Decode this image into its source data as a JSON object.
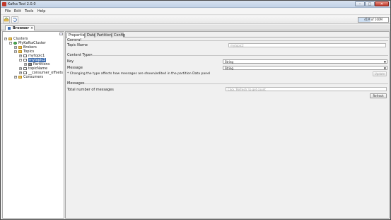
{
  "window": {
    "title": "Kafka Tool  2.0.0",
    "icons": {
      "app": "kafka-app-icon",
      "minimize": "minimize-icon",
      "maximize": "maximize-icon",
      "close": "close-icon"
    }
  },
  "menu": {
    "file": "File",
    "edit": "Edit",
    "tools": "Tools",
    "help": "Help"
  },
  "toolbar": {
    "connect_icon": "connect-icon",
    "refresh_icon": "refresh-icon",
    "memory_text": "41M of 100M",
    "memory_fraction": 0.41
  },
  "browser_tab": {
    "label": "Browser",
    "close": "×"
  },
  "tree": {
    "root": "Clusters",
    "cluster": "MyKafkaCluster",
    "brokers": "Brokers",
    "topics": "Topics",
    "topic_items": [
      "mytopic1",
      "mytopic2"
    ],
    "partitions": "Partitions",
    "topic_more": [
      "topicName",
      "__consumer_offsets"
    ],
    "consumers": "Consumers"
  },
  "detail": {
    "tabs": [
      "Properties",
      "Data",
      "Partitions",
      "Config"
    ],
    "general": {
      "title": "General",
      "topic_name_label": "Topic Name",
      "topic_name_value": "mytopic2"
    },
    "content_types": {
      "title": "Content Types",
      "key_label": "Key",
      "key_value": "String",
      "message_label": "Message",
      "message_value": "String",
      "note": "* Changing the type affects how messages are shown/edited in the partition Data panel",
      "update_button": "Update"
    },
    "messages": {
      "title": "Messages",
      "total_label": "Total number of messages",
      "total_placeholder": "Click 'Refresh' to get count",
      "refresh_button": "Refresh"
    }
  },
  "colors": {
    "selection": "#3d6db0",
    "folder": "#e8c35a",
    "cluster": "#4caf50"
  }
}
